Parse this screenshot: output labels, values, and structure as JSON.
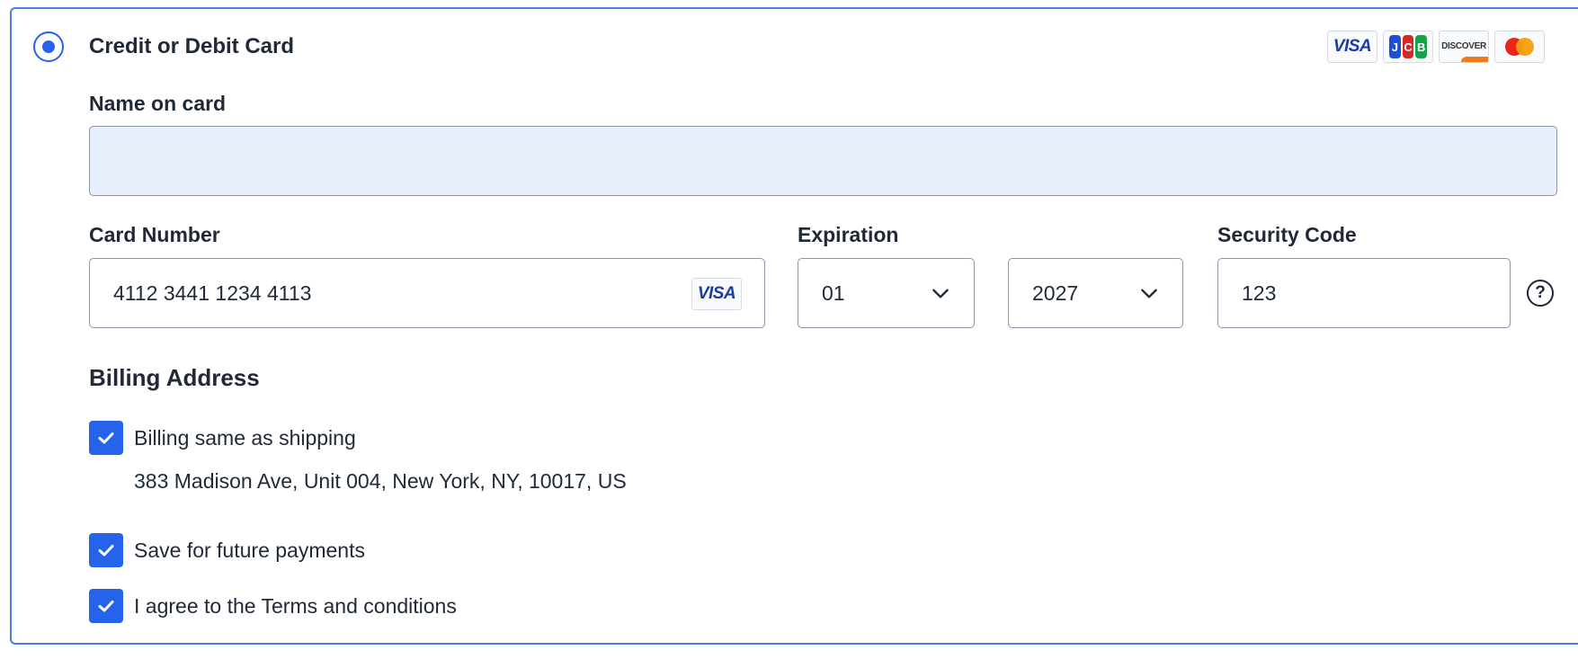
{
  "payment_option": {
    "title": "Credit or Debit Card",
    "selected": true,
    "accepted_brands": [
      "visa-icon",
      "jcb-icon",
      "discover-icon",
      "mastercard-icon"
    ],
    "brand_labels": {
      "visa": "VISA",
      "discover": "DISCOVER",
      "jcb": [
        "J",
        "C",
        "B"
      ]
    }
  },
  "form": {
    "name_label": "Name on card",
    "name_value": "",
    "card_number_label": "Card Number",
    "card_number_value": "4112 3441 1234 4113",
    "card_brand_detected": "VISA",
    "expiration_label": "Expiration",
    "exp_month": "01",
    "exp_year": "2027",
    "security_label": "Security Code",
    "security_value": "123",
    "help_symbol": "?"
  },
  "billing": {
    "heading": "Billing Address",
    "same_as_shipping_label": "Billing same as shipping",
    "same_as_shipping_checked": true,
    "address": "383 Madison Ave, Unit 004, New York, NY, 10017, US",
    "save_label": "Save for future payments",
    "save_checked": true,
    "terms_label": "I agree to the Terms and conditions",
    "terms_checked": true
  },
  "colors": {
    "accent": "#2563eb",
    "panel_border": "#4a7fe0",
    "autofill_bg": "#e8effc"
  }
}
